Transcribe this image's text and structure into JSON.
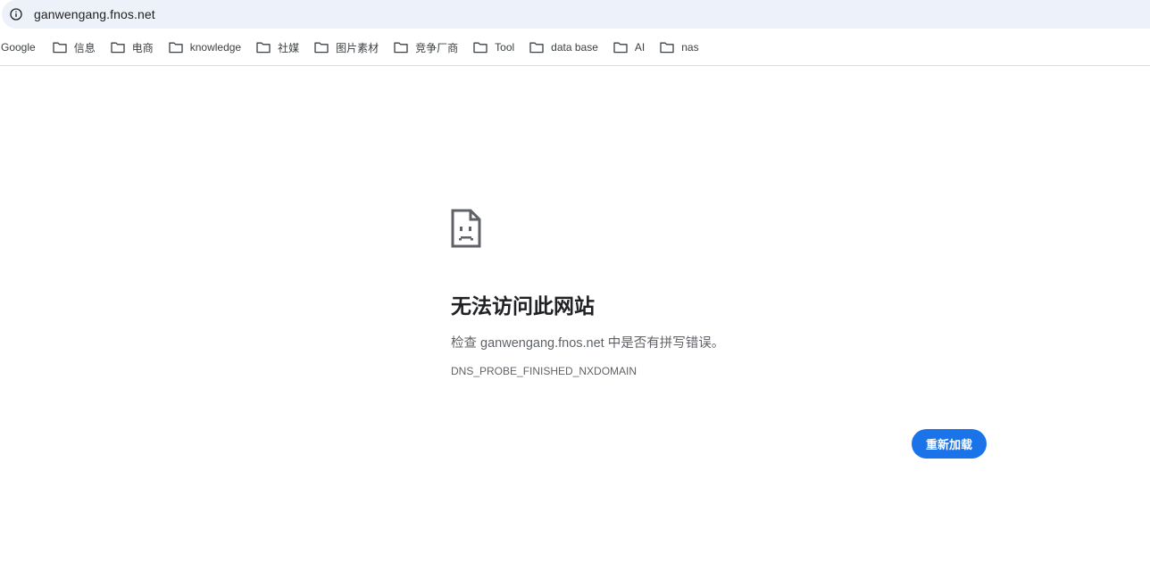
{
  "omnibox": {
    "url": "ganwengang.fnos.net",
    "info_icon": "info-icon"
  },
  "bookmarks": {
    "items": [
      {
        "label": "Google",
        "icon": null
      },
      {
        "label": "信息",
        "icon": "folder-icon"
      },
      {
        "label": "电商",
        "icon": "folder-icon"
      },
      {
        "label": "knowledge",
        "icon": "folder-icon"
      },
      {
        "label": "社媒",
        "icon": "folder-icon"
      },
      {
        "label": "图片素材",
        "icon": "folder-icon"
      },
      {
        "label": "竞争厂商",
        "icon": "folder-icon"
      },
      {
        "label": "Tool",
        "icon": "folder-icon"
      },
      {
        "label": "data base",
        "icon": "folder-icon"
      },
      {
        "label": "AI",
        "icon": "folder-icon"
      },
      {
        "label": "nas",
        "icon": "folder-icon"
      }
    ]
  },
  "error": {
    "icon": "sad-page-icon",
    "title": "无法访问此网站",
    "description": "检查 ganwengang.fnos.net 中是否有拼写错误。",
    "code": "DNS_PROBE_FINISHED_NXDOMAIN",
    "reload_label": "重新加载"
  },
  "colors": {
    "accent": "#1a73e8",
    "omnibox_bg": "#edf2fa"
  }
}
